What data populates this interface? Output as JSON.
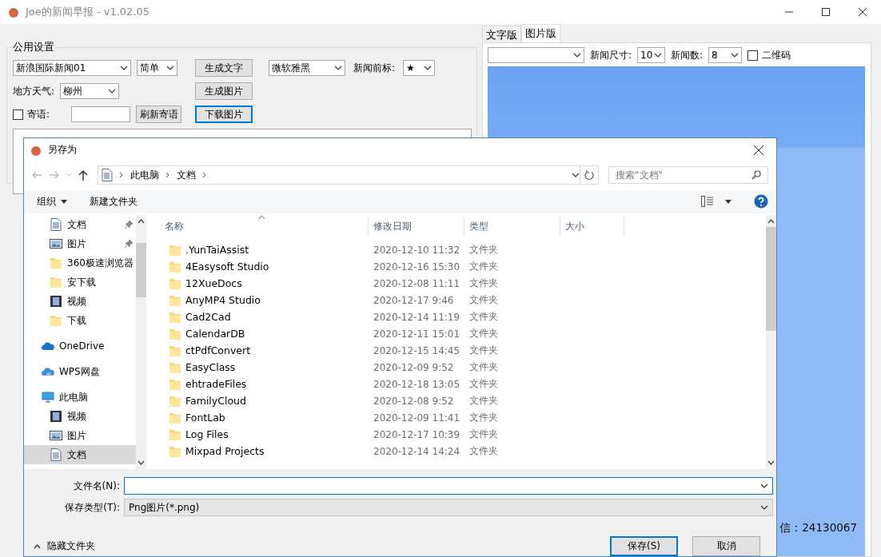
{
  "window": {
    "title": "Joe的新闻早报 - v1.02.05"
  },
  "settings": {
    "title": "公用设置",
    "source": "新浪国际新闻01",
    "style": "简单",
    "font": "微软雅黑",
    "prefix_label": "新闻前标:",
    "prefix": "★",
    "weather_label": "地方天气:",
    "city": "柳州",
    "message": {
      "label": "寄语:",
      "checked": false
    },
    "refresh_button": "刷新寄语",
    "buttons": [
      {
        "label": "生成文字",
        "focused": false
      },
      {
        "label": "生成图片",
        "focused": false
      },
      {
        "label": "下载图片",
        "focused": true
      }
    ]
  },
  "preview": {
    "tabs": [
      {
        "label": "文字版",
        "selected": false
      },
      {
        "label": "图片版",
        "selected": true
      }
    ],
    "size_label": "新闻尺寸:",
    "size": "10",
    "count_label": "新闻数:",
    "count": "8",
    "qr": {
      "label": "二维码",
      "checked": false
    },
    "footer_text": "信：24130067"
  },
  "dialog": {
    "title": "另存为",
    "breadcrumb": [
      "此电脑",
      "文档"
    ],
    "search": {
      "placeholder": "搜索\"文档\""
    },
    "toolbar": {
      "organize": "组织",
      "new_folder": "新建文件夹"
    },
    "nav": [
      {
        "kind": "group",
        "children": [
          {
            "label": "文档",
            "kind": "doc",
            "pinned": true,
            "selected": false
          },
          {
            "label": "图片",
            "kind": "pic",
            "pinned": true,
            "selected": false
          },
          {
            "label": "360极速浏览器",
            "kind": "folder",
            "pinned": false,
            "selected": false
          },
          {
            "label": "安下载",
            "kind": "folder",
            "pinned": false,
            "selected": false
          },
          {
            "label": "视频",
            "kind": "video",
            "pinned": false,
            "selected": false
          },
          {
            "label": "下载",
            "kind": "folder",
            "pinned": false,
            "selected": false
          }
        ]
      },
      {
        "label": "OneDrive",
        "kind": "cloud",
        "pinned": false,
        "selected": false
      },
      {
        "label": "WPS网盘",
        "kind": "cloud2",
        "pinned": false,
        "selected": false
      },
      {
        "label": "此电脑",
        "kind": "pc",
        "pinned": false,
        "selected": false,
        "children": [
          {
            "label": "视频",
            "kind": "video",
            "pinned": false,
            "selected": false
          },
          {
            "label": "图片",
            "kind": "pic",
            "pinned": false,
            "selected": false
          },
          {
            "label": "文档",
            "kind": "doc",
            "pinned": false,
            "selected": true
          }
        ]
      }
    ],
    "columns": [
      "名称",
      "修改日期",
      "类型",
      "大小"
    ],
    "rows": [
      {
        "name": ".YunTaiAssist",
        "date": "2020-12-10 11:32",
        "type": "文件夹"
      },
      {
        "name": "4Easysoft Studio",
        "date": "2020-12-16 15:30",
        "type": "文件夹"
      },
      {
        "name": "12XueDocs",
        "date": "2020-12-08 11:11",
        "type": "文件夹"
      },
      {
        "name": "AnyMP4 Studio",
        "date": "2020-12-17 9:46",
        "type": "文件夹"
      },
      {
        "name": "Cad2Cad",
        "date": "2020-12-14 11:19",
        "type": "文件夹"
      },
      {
        "name": "CalendarDB",
        "date": "2020-12-11 15:01",
        "type": "文件夹"
      },
      {
        "name": "ctPdfConvert",
        "date": "2020-12-15 14:45",
        "type": "文件夹"
      },
      {
        "name": "EasyClass",
        "date": "2020-12-09 9:52",
        "type": "文件夹"
      },
      {
        "name": "ehtradeFiles",
        "date": "2020-12-18 13:05",
        "type": "文件夹"
      },
      {
        "name": "FamilyCloud",
        "date": "2020-12-08 9:52",
        "type": "文件夹"
      },
      {
        "name": "FontLab",
        "date": "2020-12-09 11:41",
        "type": "文件夹"
      },
      {
        "name": "Log Files",
        "date": "2020-12-17 10:39",
        "type": "文件夹"
      },
      {
        "name": "Mixpad Projects",
        "date": "2020-12-14 14:24",
        "type": "文件夹"
      }
    ],
    "filename": {
      "label": "文件名(N):"
    },
    "filetype": {
      "label": "保存类型(T):",
      "value": "Png图片(*.png)"
    },
    "hide_folders": "隐藏文件夹",
    "buttons": [
      {
        "label": "保存(S)",
        "default": true
      },
      {
        "label": "取消",
        "default": false
      }
    ]
  }
}
